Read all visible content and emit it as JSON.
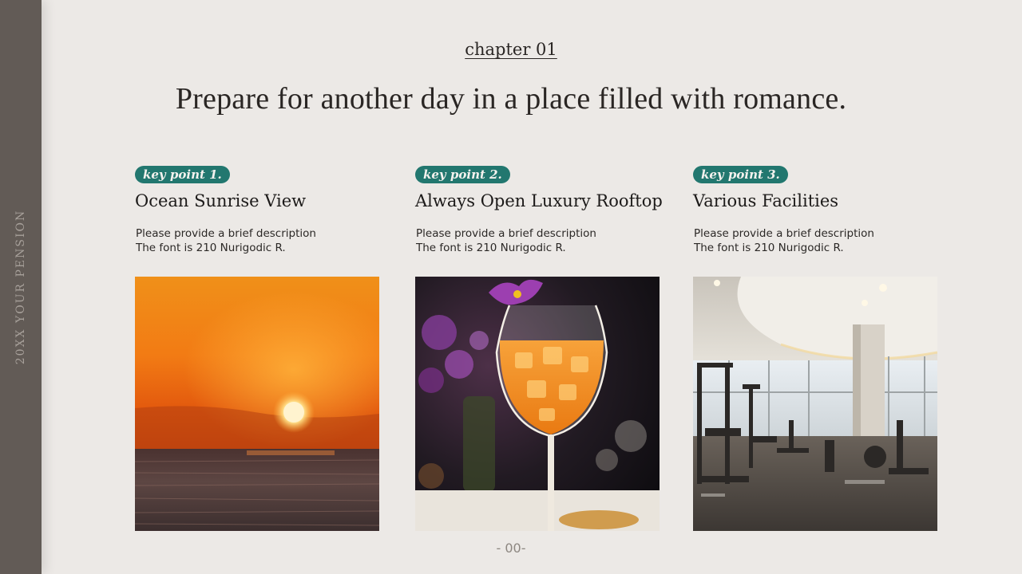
{
  "sidebar": {
    "label": "20XX YOUR PENSION"
  },
  "header": {
    "chapter": "chapter 01",
    "headline": "Prepare for another day in a place filled with romance."
  },
  "cards": [
    {
      "badge": "key point 1.",
      "title": "Ocean Sunrise View",
      "desc_line1": "Please provide a brief description",
      "desc_line2": "The font is 210 Nurigodic R.",
      "photo": "ocean-sunrise-photo"
    },
    {
      "badge": "key point 2.",
      "title": "Always Open Luxury Rooftop",
      "desc_line1": "Please provide a brief description",
      "desc_line2": "The font is 210 Nurigodic R.",
      "photo": "cocktail-rooftop-photo"
    },
    {
      "badge": "key point 3.",
      "title": "Various Facilities",
      "desc_line1": "Please provide a brief description",
      "desc_line2": "The font is 210 Nurigodic R.",
      "photo": "fitness-gym-photo"
    }
  ],
  "footer": {
    "page_number": "- 00-"
  },
  "colors": {
    "background": "#ece9e6",
    "sidebar": "#625b56",
    "accent_teal": "#22776f",
    "text_dark": "#2a2624"
  }
}
